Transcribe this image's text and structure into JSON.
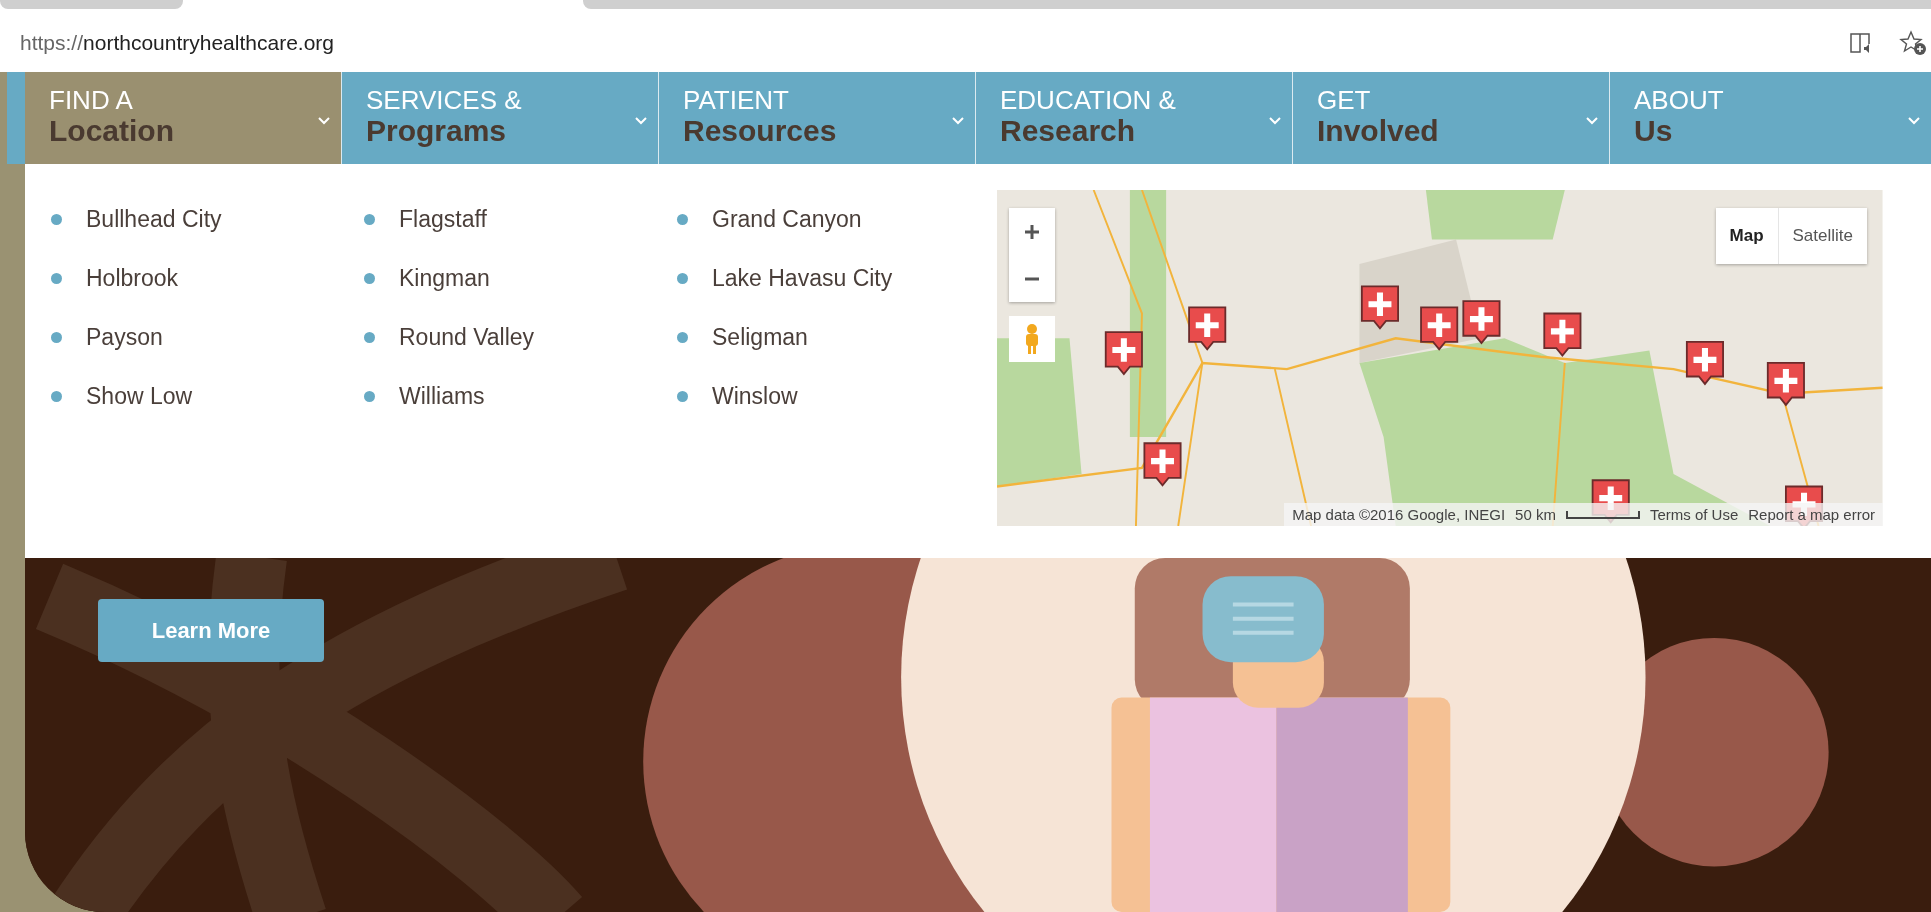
{
  "browser": {
    "url_scheme": "https://",
    "url_host": "northcountryhealthcare.org"
  },
  "nav": {
    "tabs": [
      {
        "top": "FIND A",
        "bottom": "Location",
        "selected": true
      },
      {
        "top": "SERVICES &",
        "bottom": "Programs",
        "selected": false
      },
      {
        "top": "PATIENT",
        "bottom": "Resources",
        "selected": false
      },
      {
        "top": "EDUCATION &",
        "bottom": "Research",
        "selected": false
      },
      {
        "top": "GET",
        "bottom": "Involved",
        "selected": false
      },
      {
        "top": "ABOUT",
        "bottom": "Us",
        "selected": false
      }
    ]
  },
  "locations": {
    "columns": [
      [
        "Bullhead City",
        "Holbrook",
        "Payson",
        "Show Low"
      ],
      [
        "Flagstaff",
        "Kingman",
        "Round Valley",
        "Williams"
      ],
      [
        "Grand Canyon",
        "Lake Havasu City",
        "Seligman",
        "Winslow"
      ]
    ]
  },
  "map": {
    "type_buttons": [
      {
        "label": "Map",
        "selected": true
      },
      {
        "label": "Satellite",
        "selected": false
      }
    ],
    "attribution": "Map data ©2016 Google, INEGI",
    "scale": "50 km",
    "terms": "Terms of Use",
    "report": "Report a map error"
  },
  "hero": {
    "button": "Learn More"
  }
}
